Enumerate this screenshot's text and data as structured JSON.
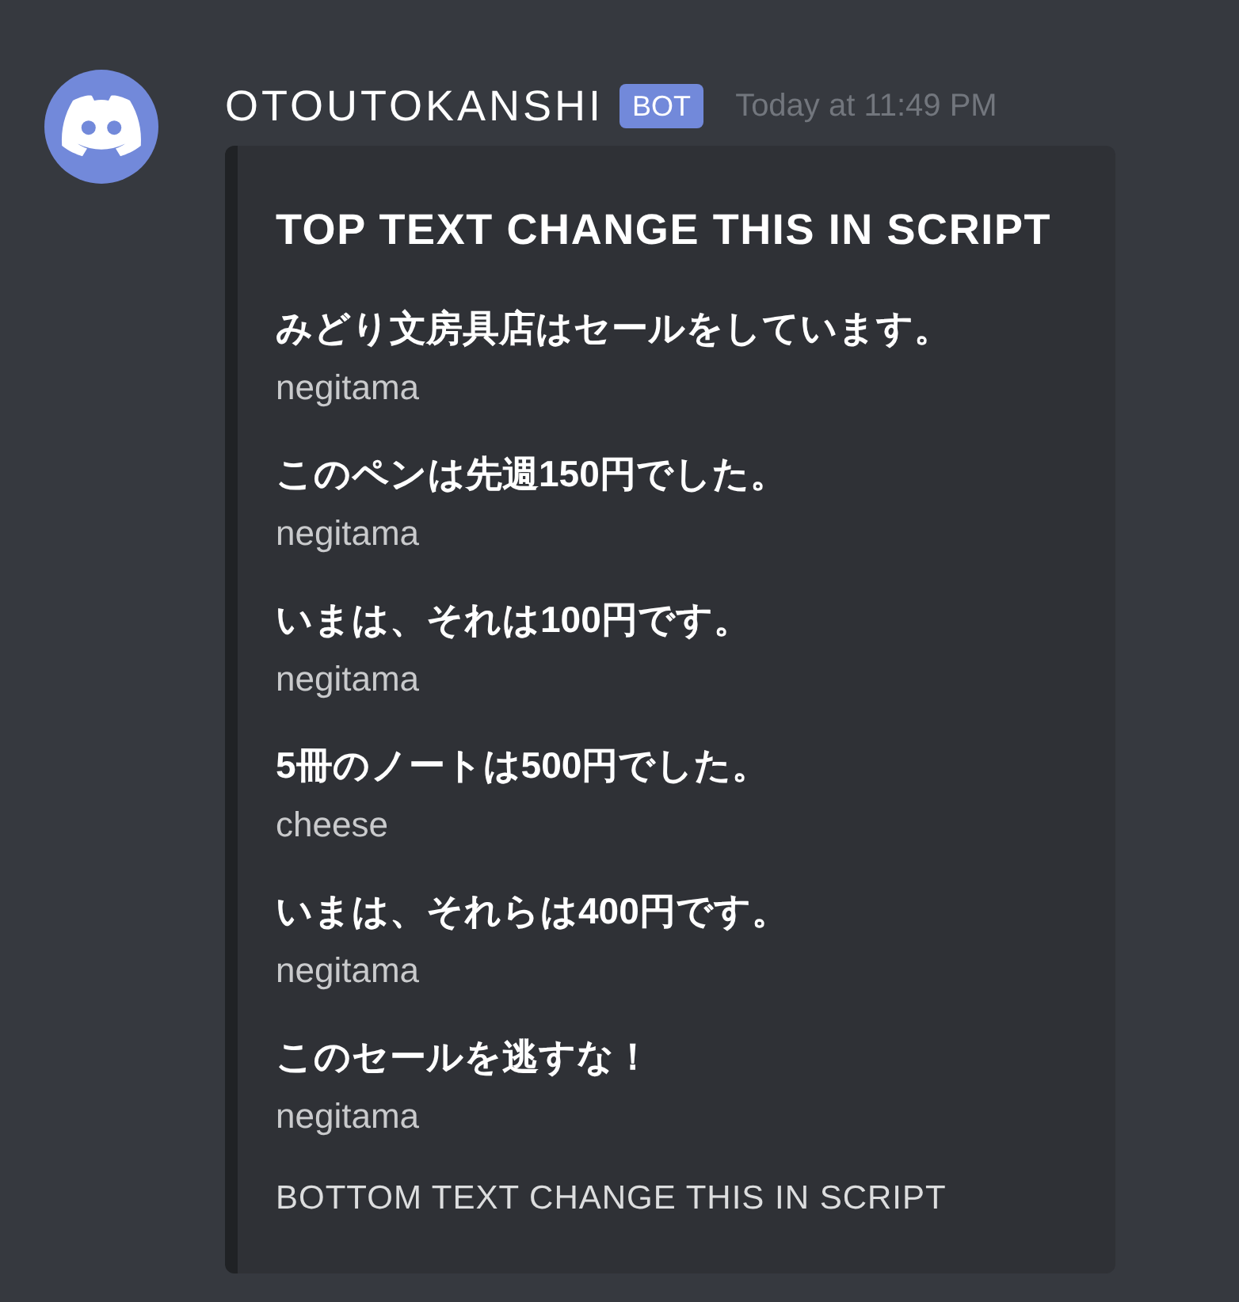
{
  "message": {
    "author": "OTOUTOKANSHI",
    "badge": "BOT",
    "timestamp": "Today at 11:49 PM"
  },
  "embed": {
    "title": "TOP TEXT CHANGE THIS IN SCRIPT",
    "fields": [
      {
        "name": "みどり文房具店はセールをしています。",
        "value": "negitama"
      },
      {
        "name": "このペンは先週150円でした。",
        "value": "negitama"
      },
      {
        "name": "いまは、それは100円です。",
        "value": "negitama"
      },
      {
        "name": "5冊のノートは500円でした。",
        "value": "cheese"
      },
      {
        "name": "いまは、それらは400円です。",
        "value": "negitama"
      },
      {
        "name": "このセールを逃すな！",
        "value": "negitama"
      }
    ],
    "footer": "BOTTOM TEXT CHANGE THIS IN SCRIPT"
  }
}
